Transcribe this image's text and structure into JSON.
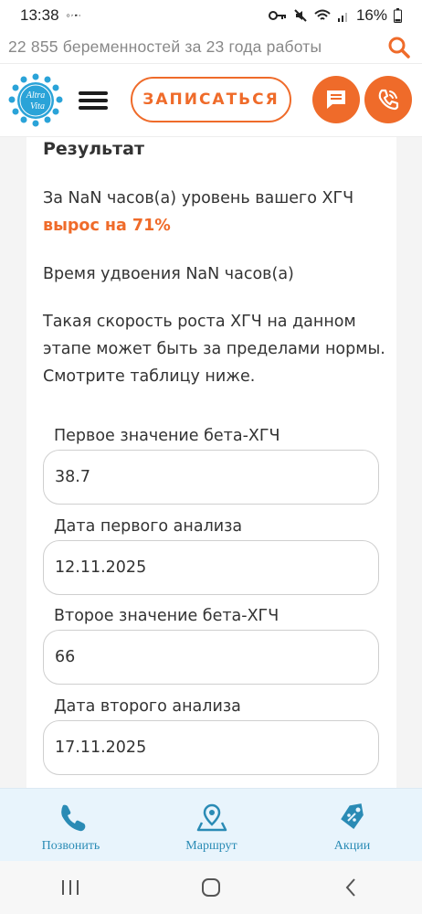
{
  "status_bar": {
    "time": "13:38",
    "battery": "16%"
  },
  "search_banner": {
    "text": "22 855 беременностей за 23 года работы"
  },
  "header": {
    "logo_text_top": "Altra",
    "logo_text_bottom": "Vita",
    "signup_label": "ЗАПИСАТЬСЯ"
  },
  "result": {
    "title": "Результат",
    "line1": "За NaN часов(а) уровень вашего ХГЧ",
    "growth": "вырос на 71%",
    "doubling": "Время удвоения NaN часов(а)",
    "warning_line1": "Такая скорость роста ХГЧ на данном",
    "warning_line2": "этапе может быть за пределами нормы.",
    "warning_line3": "Смотрите таблицу ниже."
  },
  "form": {
    "fields": [
      {
        "label": "Первое значение бета-ХГЧ",
        "value": "38.7"
      },
      {
        "label": "Дата первого анализа",
        "value": "12.11.2025"
      },
      {
        "label": "Второе значение бета-ХГЧ",
        "value": "66"
      },
      {
        "label": "Дата второго анализа",
        "value": "17.11.2025"
      }
    ]
  },
  "bottom_nav": {
    "call": "Позвонить",
    "route": "Маршрут",
    "promo": "Акции"
  },
  "colors": {
    "accent": "#ef6b2a",
    "nav_blue": "#2a8bb5",
    "nav_bg": "#e8f4fc"
  }
}
